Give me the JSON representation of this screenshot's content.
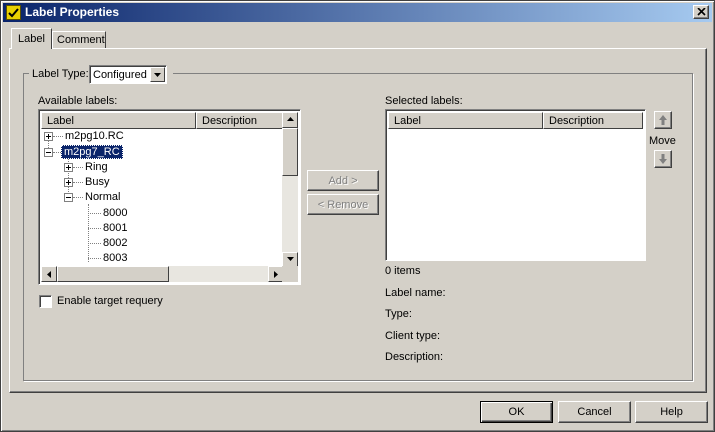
{
  "window": {
    "title": "Label Properties"
  },
  "tabs": [
    {
      "label": "Label"
    },
    {
      "label": "Comment"
    }
  ],
  "label_type": {
    "caption": "Label Type:",
    "selected": "Configured"
  },
  "available": {
    "caption": "Available labels:",
    "columns": [
      "Label",
      "Description"
    ],
    "tree": [
      {
        "label": "m2pg10.RC",
        "expander": "+"
      },
      {
        "label": "m2pg7_RC",
        "expander": "-"
      },
      {
        "label": "Ring",
        "expander": "+"
      },
      {
        "label": "Busy",
        "expander": "+"
      },
      {
        "label": "Normal",
        "expander": "-"
      },
      {
        "label": "8000"
      },
      {
        "label": "8001"
      },
      {
        "label": "8002"
      },
      {
        "label": "8003"
      }
    ]
  },
  "buttons": {
    "add": "Add >",
    "remove": "< Remove",
    "ok": "OK",
    "cancel": "Cancel",
    "help": "Help"
  },
  "selected": {
    "caption": "Selected labels:",
    "columns": [
      "Label",
      "Description"
    ],
    "count": "0 items",
    "move_caption": "Move"
  },
  "details": {
    "label_name": "Label name:",
    "type": "Type:",
    "client_type": "Client type:",
    "description": "Description:"
  },
  "options": {
    "enable_target_requery": "Enable target requery",
    "enable_target_requery_checked": false
  },
  "colors": {
    "titlebar_start": "#0a246a",
    "titlebar_end": "#a6caf0",
    "face": "#d4d0c8",
    "selection": "#0a246a"
  }
}
